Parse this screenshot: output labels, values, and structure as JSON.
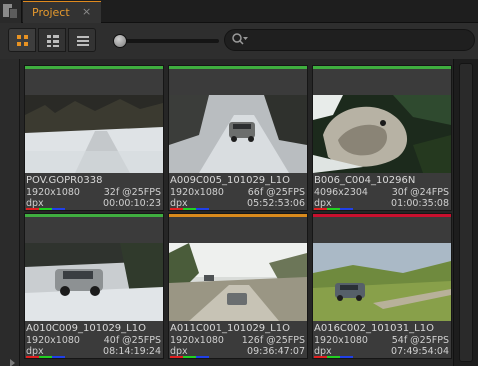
{
  "tab": {
    "label": "Project",
    "close_glyph": "×",
    "accent": "#e69a2e"
  },
  "toolbar": {
    "views": [
      "grid-large",
      "grid-small",
      "list"
    ],
    "active_view": "grid-large",
    "thumb_size_slider": 0
  },
  "clips": [
    {
      "name": "POV.GOPR0338",
      "resolution": "1920x1080",
      "fps": "32f @25FPS",
      "format": "dpx",
      "duration": "00:00:10:23",
      "status_color": "#3fae3f"
    },
    {
      "name": "A009C005_101029_L1O",
      "resolution": "1920x1080",
      "fps": "66f @25FPS",
      "format": "dpx",
      "duration": "05:52:53:06",
      "status_color": "#3fae3f"
    },
    {
      "name": "B006_C004_10296N",
      "resolution": "4096x2304",
      "fps": "30f @24FPS",
      "format": "dpx",
      "duration": "01:00:35:08",
      "status_color": "#3fae3f"
    },
    {
      "name": "A010C009_101029_L1O",
      "resolution": "1920x1080",
      "fps": "40f @25FPS",
      "format": "dpx",
      "duration": "08:14:19:24",
      "status_color": "#3fae3f"
    },
    {
      "name": "A011C001_101029_L1O",
      "resolution": "1920x1080",
      "fps": "126f @25FPS",
      "format": "dpx",
      "duration": "09:36:47:07",
      "status_color": "#d98a1c"
    },
    {
      "name": "A016C002_101031_L1O",
      "resolution": "1920x1080",
      "fps": "54f @25FPS",
      "format": "dpx",
      "duration": "07:49:54:04",
      "status_color": "#c8102e"
    }
  ]
}
